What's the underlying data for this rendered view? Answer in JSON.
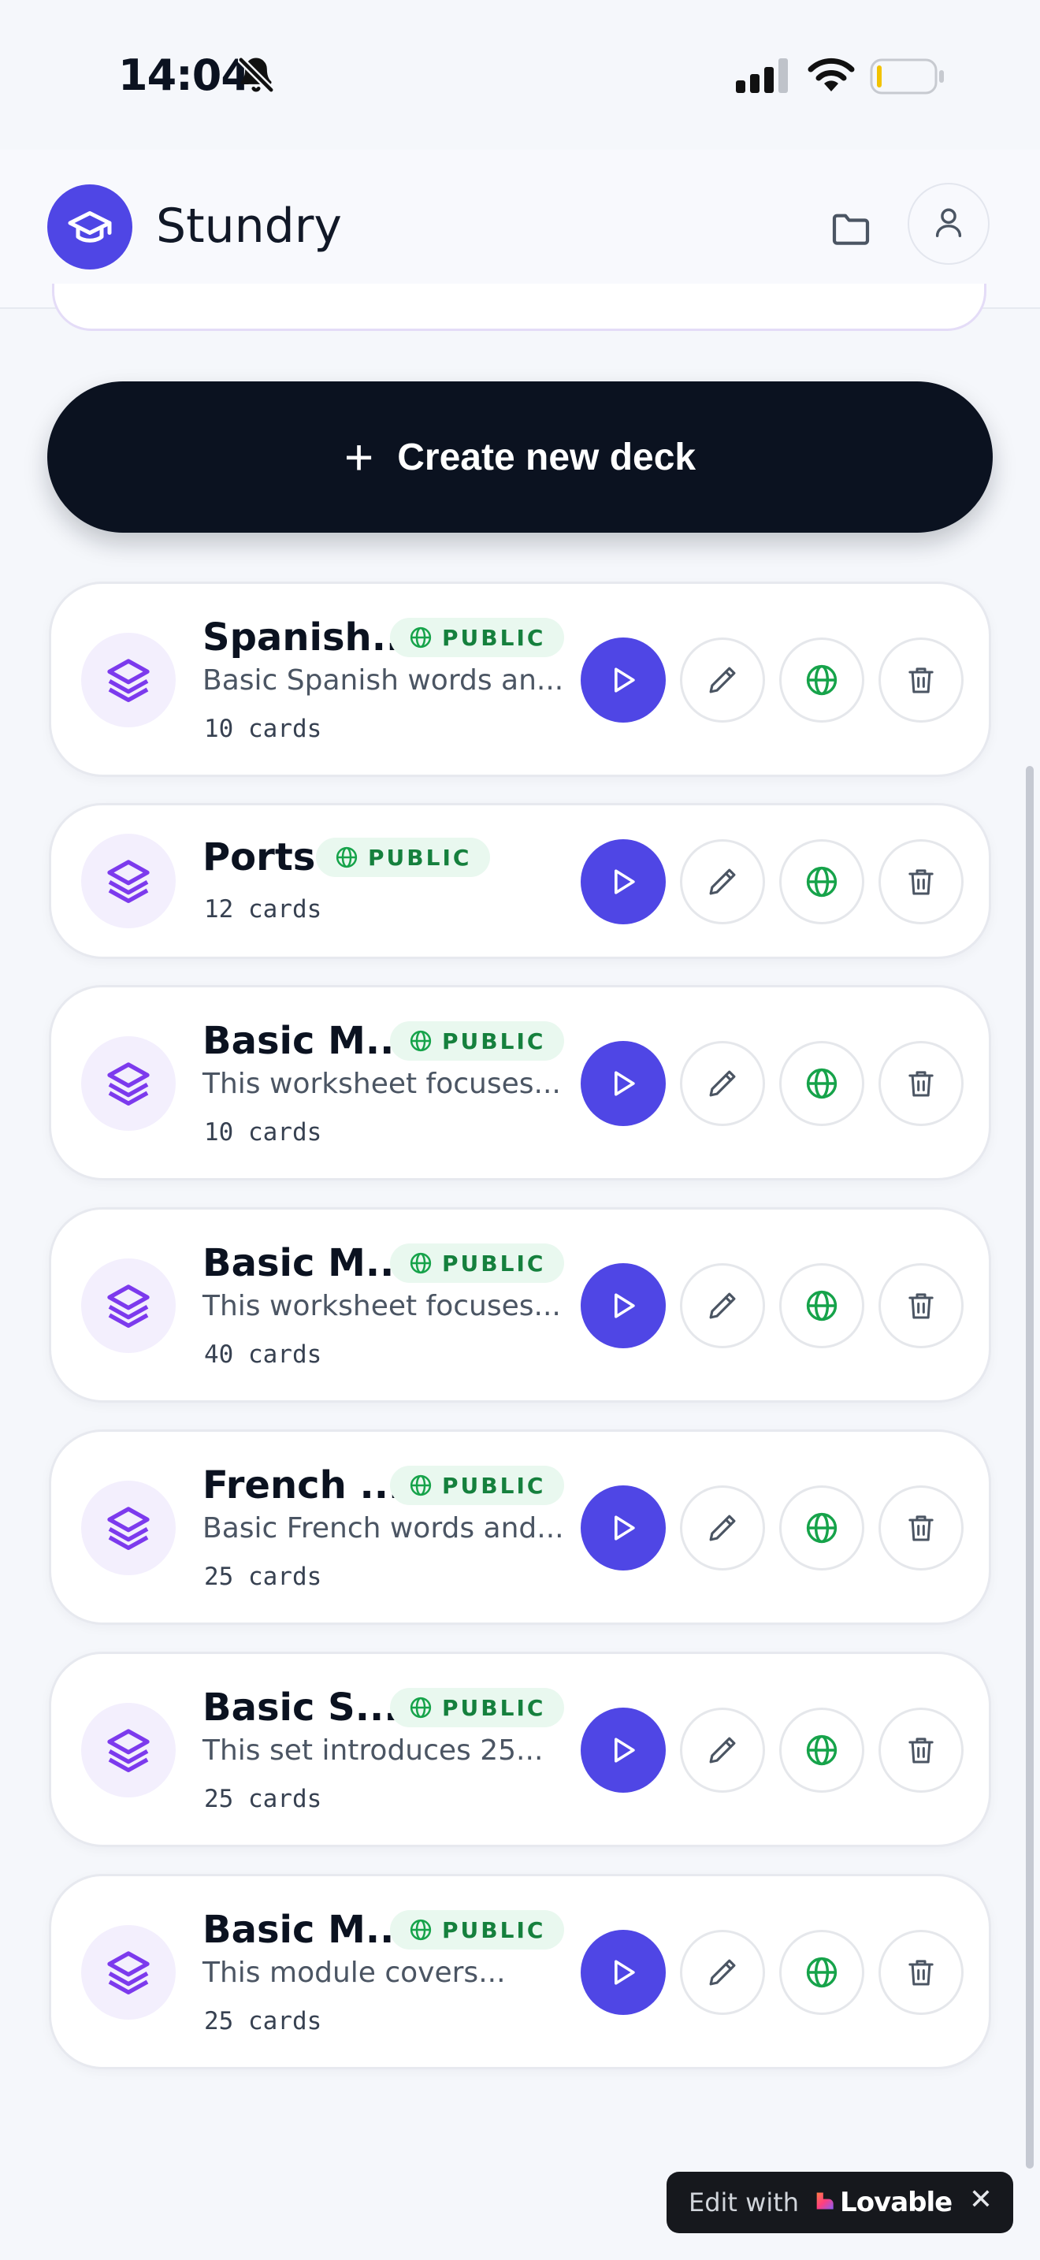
{
  "status_bar": {
    "time": "14:04"
  },
  "header": {
    "app_name": "Stundry"
  },
  "create_button": {
    "label": "Create new deck"
  },
  "decks": [
    {
      "title": "Spanish...",
      "badge": "PUBLIC",
      "description": "Basic Spanish words an...",
      "count": "10 cards"
    },
    {
      "title": "Ports",
      "badge": "PUBLIC",
      "description": "",
      "count": "12 cards"
    },
    {
      "title": "Basic M...",
      "badge": "PUBLIC",
      "description": "This worksheet focuses...",
      "count": "10 cards"
    },
    {
      "title": "Basic M...",
      "badge": "PUBLIC",
      "description": "This worksheet focuses...",
      "count": "40 cards"
    },
    {
      "title": "French ...",
      "badge": "PUBLIC",
      "description": "Basic French words and...",
      "count": "25 cards"
    },
    {
      "title": "Basic S...",
      "badge": "PUBLIC",
      "description": "This set introduces 25...",
      "count": "25 cards"
    },
    {
      "title": "Basic M...",
      "badge": "PUBLIC",
      "description": "This module covers...",
      "count": "25 cards"
    }
  ],
  "lovable_badge": {
    "edit_text": "Edit with",
    "brand": "Lovable",
    "close": "✕"
  },
  "icons": {
    "logo": "graduation-cap-icon",
    "folder": "folder-icon",
    "profile": "user-icon",
    "deck": "layers-icon",
    "play": "play-icon",
    "edit": "pencil-icon",
    "publish": "globe-icon",
    "delete": "trash-icon"
  },
  "colors": {
    "accent": "#4f46e5",
    "dark_button": "#0b1220",
    "public_badge_bg": "#e9f8ef",
    "public_badge_text": "#15803d",
    "deck_icon": "#7c3aed",
    "deck_icon_bg": "#f3effd",
    "globe": "#16a34a"
  }
}
